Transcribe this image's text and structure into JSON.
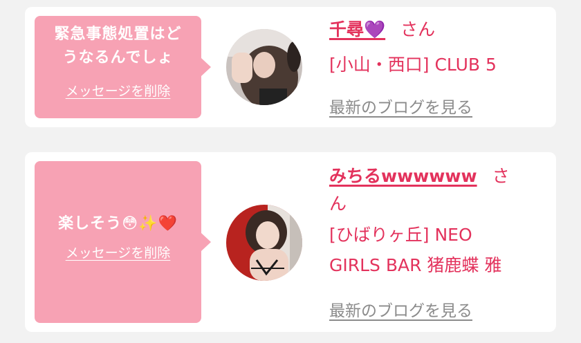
{
  "cards": [
    {
      "message": "緊急事態処置はどうなるんでしょ",
      "message_line1": "緊急事態処置はど",
      "message_line2": "うなるんでしょ",
      "delete_label": "メッセージを削除",
      "name": "千尋💜",
      "san": "さん",
      "shop": "[小山・西口] CLUB 5",
      "blog_label": "最新のブログを見る"
    },
    {
      "message": "楽しそう😳✨❤️",
      "delete_label": "メッセージを削除",
      "name": "みちるwwwwww",
      "san": "さ",
      "san_line2": "ん",
      "shop_line1": "[ひばりヶ丘] NEO",
      "shop_line2": "GIRLS BAR 猪鹿蝶 雅",
      "blog_label": "最新のブログを見る"
    }
  ],
  "colors": {
    "accent": "#e3325c",
    "bubble": "#f7a2b4",
    "background": "#f2f2f2",
    "card": "#ffffff",
    "link_gray": "#8b8b8b"
  }
}
